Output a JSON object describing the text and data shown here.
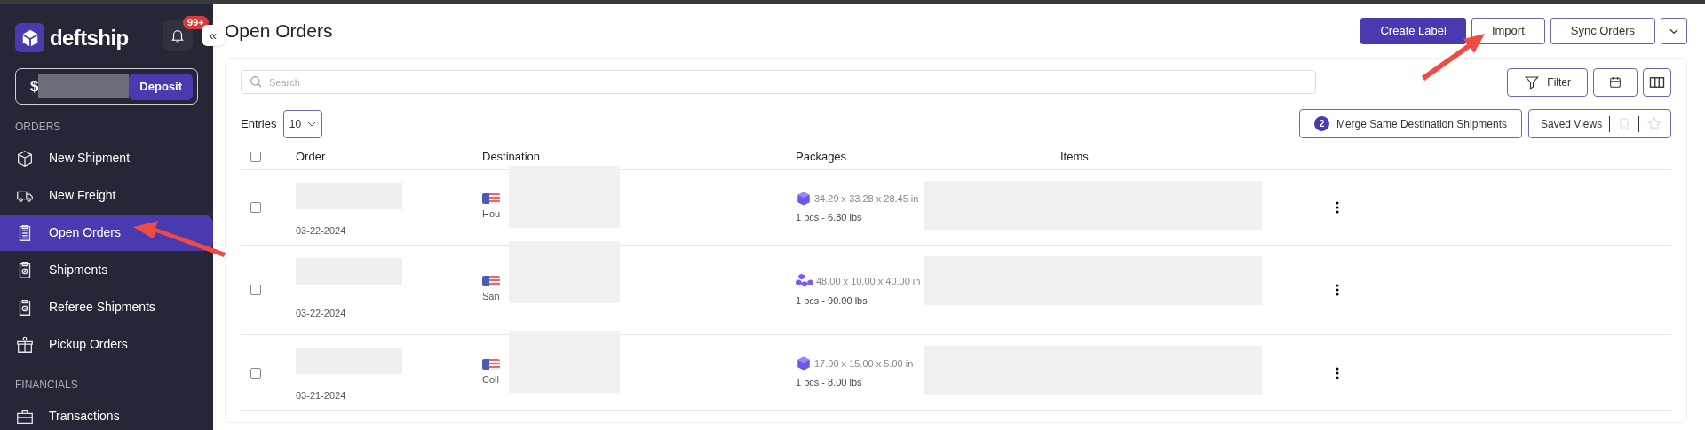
{
  "sidebar": {
    "brand": "deftship",
    "notifications_badge": "99+",
    "collapse_button": "«",
    "balance": {
      "currency": "$",
      "deposit_button": "Deposit"
    },
    "sections": [
      {
        "heading": "ORDERS",
        "items": [
          {
            "label": "New Shipment",
            "kind": "box",
            "selected": false
          },
          {
            "label": "New Freight",
            "kind": "truck",
            "selected": false
          },
          {
            "label": "Open Orders",
            "kind": "clipboard",
            "selected": true
          },
          {
            "label": "Shipments",
            "kind": "clipboard-check",
            "selected": false
          },
          {
            "label": "Referee Shipments",
            "kind": "clipboard-check",
            "selected": false
          },
          {
            "label": "Pickup Orders",
            "kind": "pickup",
            "selected": false
          }
        ]
      },
      {
        "heading": "FINANCIALS",
        "items": [
          {
            "label": "Transactions",
            "kind": "briefcase",
            "selected": false
          }
        ]
      }
    ]
  },
  "page": {
    "title": "Open Orders",
    "buttons": [
      {
        "label": "Create Label",
        "kind": "primary"
      },
      {
        "label": "Import",
        "kind": "outline"
      },
      {
        "label": "Sync Orders",
        "kind": "outline"
      },
      {
        "kind": "dropdown"
      }
    ]
  },
  "toolbar": {
    "search": {
      "placeholder": "Search"
    },
    "filter_button": "Filter",
    "entries_label": "Entries",
    "entries_value": "10",
    "merge_count": "2",
    "merge_button": "Merge Same Destination Shipments",
    "saved_views": "Saved Views"
  },
  "table": {
    "header_checked": false,
    "columns": [
      "Order",
      "Destination",
      "Packages",
      "Items"
    ],
    "rows": [
      {
        "checked": false,
        "date": "03-22-2024",
        "destination": "Hou",
        "kind": "single",
        "dimensions": "34.29 x 33.28 x 28.45 in",
        "quantity_weight": "1 pcs - 6.80 lbs"
      },
      {
        "checked": false,
        "date": "03-22-2024",
        "destination": "San",
        "kind": "multi",
        "dimensions": "48.00 x 10.00 x 40.00 in",
        "quantity_weight": "1 pcs - 90.00 lbs"
      },
      {
        "checked": false,
        "date": "03-21-2024",
        "destination": "Coll",
        "kind": "single",
        "dimensions": "17.00 x 15.00 x 5.00 in",
        "quantity_weight": "1 pcs - 8.00 lbs"
      }
    ]
  }
}
